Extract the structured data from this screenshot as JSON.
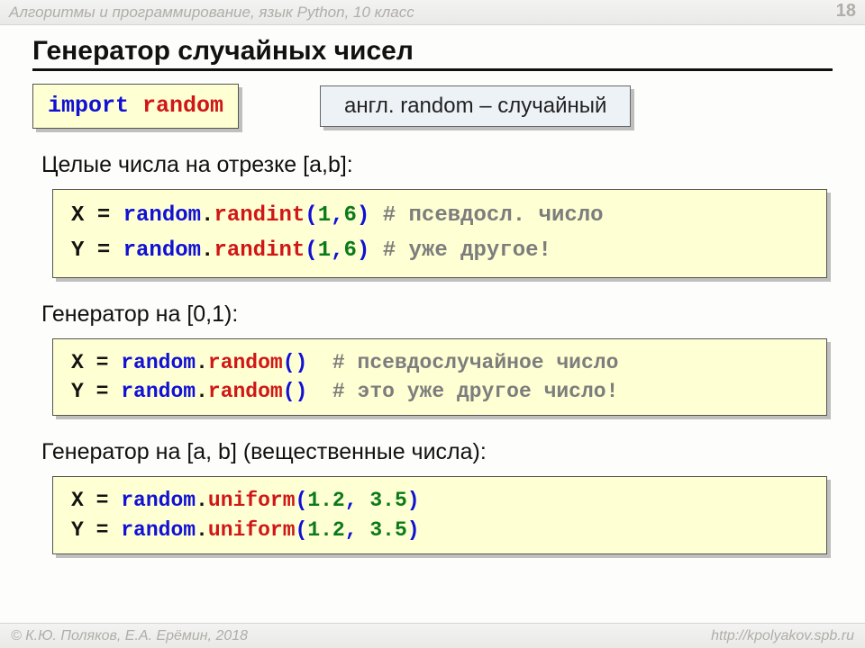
{
  "header": {
    "title": "Алгоритмы и программирование, язык Python, 10 класс",
    "page": "18"
  },
  "title": "Генератор случайных чисел",
  "import_box": {
    "kw": "import",
    "mod": "random"
  },
  "tip": "англ. random – случайный",
  "sec1": {
    "label": "Целые числа на отрезке [a,b]:",
    "l1": {
      "var": "X",
      "eq": "=",
      "obj": "random",
      "dot": ".",
      "fn": "randint",
      "op": "(",
      "a1": "1",
      "c": ",",
      "a2": "6",
      "cp": ")",
      "cm": " # псевдосл. число"
    },
    "l2": {
      "var": "Y",
      "eq": "=",
      "obj": "random",
      "dot": ".",
      "fn": "randint",
      "op": "(",
      "a1": "1",
      "c": ",",
      "a2": "6",
      "cp": ")",
      "cm": " # уже другое!"
    }
  },
  "sec2": {
    "label": "Генератор на [0,1):",
    "l1": {
      "var": "X",
      "eq": "=",
      "obj": "random",
      "dot": ".",
      "fn": "random",
      "par": "()",
      "cm": "  # псевдослучайное число"
    },
    "l2": {
      "var": "Y",
      "eq": "=",
      "obj": "random",
      "dot": ".",
      "fn": "random",
      "par": "()",
      "cm": "  # это уже другое число!"
    }
  },
  "sec3": {
    "label": "Генератор на [a, b] (вещественные числа):",
    "l1": {
      "var": "X",
      "eq": "=",
      "obj": "random",
      "dot": ".",
      "fn": "uniform",
      "op": "(",
      "a1": "1.2",
      "c": ", ",
      "a2": "3.5",
      "cp": ")"
    },
    "l2": {
      "var": "Y",
      "eq": "=",
      "obj": "random",
      "dot": ".",
      "fn": "uniform",
      "op": "(",
      "a1": "1.2",
      "c": ", ",
      "a2": "3.5",
      "cp": ")"
    }
  },
  "footer": {
    "left": "© К.Ю. Поляков, Е.А. Ерёмин, 2018",
    "right": "http://kpolyakov.spb.ru"
  }
}
